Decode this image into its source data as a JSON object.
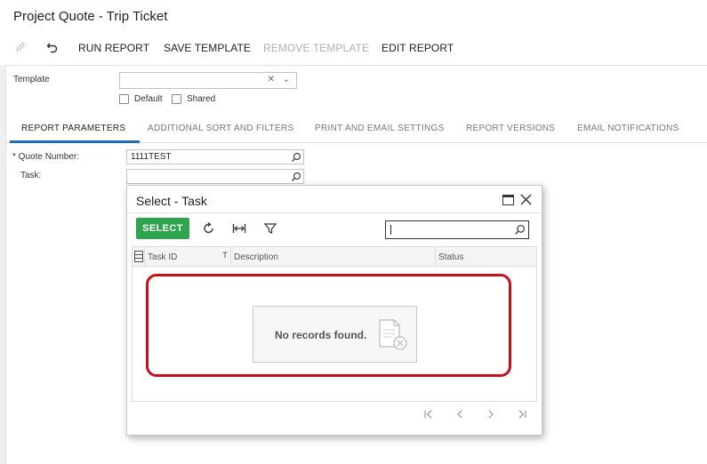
{
  "page": {
    "title": "Project Quote - Trip Ticket"
  },
  "toolbar": {
    "edit_icon": "pencil-icon",
    "undo_icon": "undo-icon",
    "run_report": "RUN REPORT",
    "save_template": "SAVE TEMPLATE",
    "remove_template": "REMOVE TEMPLATE",
    "edit_report": "EDIT REPORT"
  },
  "template": {
    "label": "Template",
    "value": "",
    "default_label": "Default",
    "shared_label": "Shared",
    "default_checked": false,
    "shared_checked": false
  },
  "tabs": [
    {
      "label": "REPORT PARAMETERS",
      "active": true
    },
    {
      "label": "ADDITIONAL SORT AND FILTERS",
      "active": false
    },
    {
      "label": "PRINT AND EMAIL SETTINGS",
      "active": false
    },
    {
      "label": "REPORT VERSIONS",
      "active": false
    },
    {
      "label": "EMAIL NOTIFICATIONS",
      "active": false
    }
  ],
  "params": {
    "quote_number_label": "* Quote Number:",
    "quote_number_value": "1111TEST",
    "task_label": "Task:",
    "task_value": ""
  },
  "dialog": {
    "title": "Select - Task",
    "select_label": "SELECT",
    "search_value": "",
    "columns": [
      "Task ID",
      "Description",
      "Status"
    ],
    "empty_message": "No records found.",
    "rows": []
  },
  "colors": {
    "accent": "#1d6fb8",
    "select_button": "#2da44e",
    "highlight": "#c8101a"
  }
}
